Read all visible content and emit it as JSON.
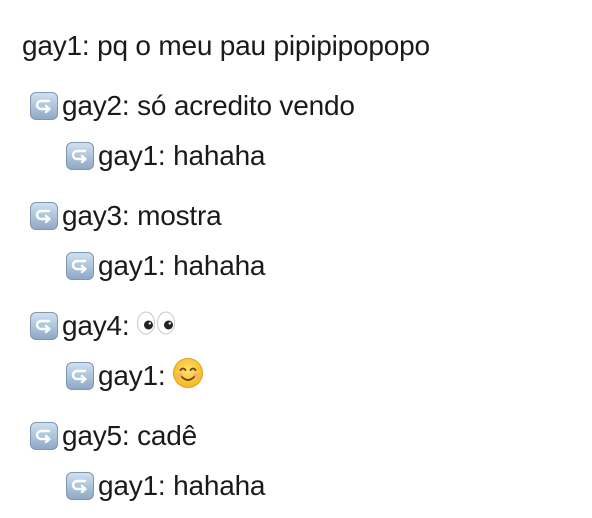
{
  "messages": [
    {
      "text": "gay1: pq o meu pau pipipipopopo",
      "emoji": null
    },
    {
      "text": "gay2: só acredito vendo",
      "emoji": null
    },
    {
      "text": "gay1: hahaha",
      "emoji": null
    },
    {
      "text": "gay3: mostra",
      "emoji": null
    },
    {
      "text": "gay1: hahaha",
      "emoji": null
    },
    {
      "text": "gay4:",
      "emoji": "eyes-emoji"
    },
    {
      "text": "gay1:",
      "emoji": "smiling-face-emoji"
    },
    {
      "text": "gay5: cadê",
      "emoji": null
    },
    {
      "text": "gay1: hahaha",
      "emoji": null
    }
  ],
  "icons": {
    "reply": "reply-arrow-icon"
  },
  "colors": {
    "text": "#1a1a1a",
    "icon_bg_top": "#cfe0f0",
    "icon_bg_bottom": "#8ea9c6",
    "smiley": "#f7c531"
  }
}
